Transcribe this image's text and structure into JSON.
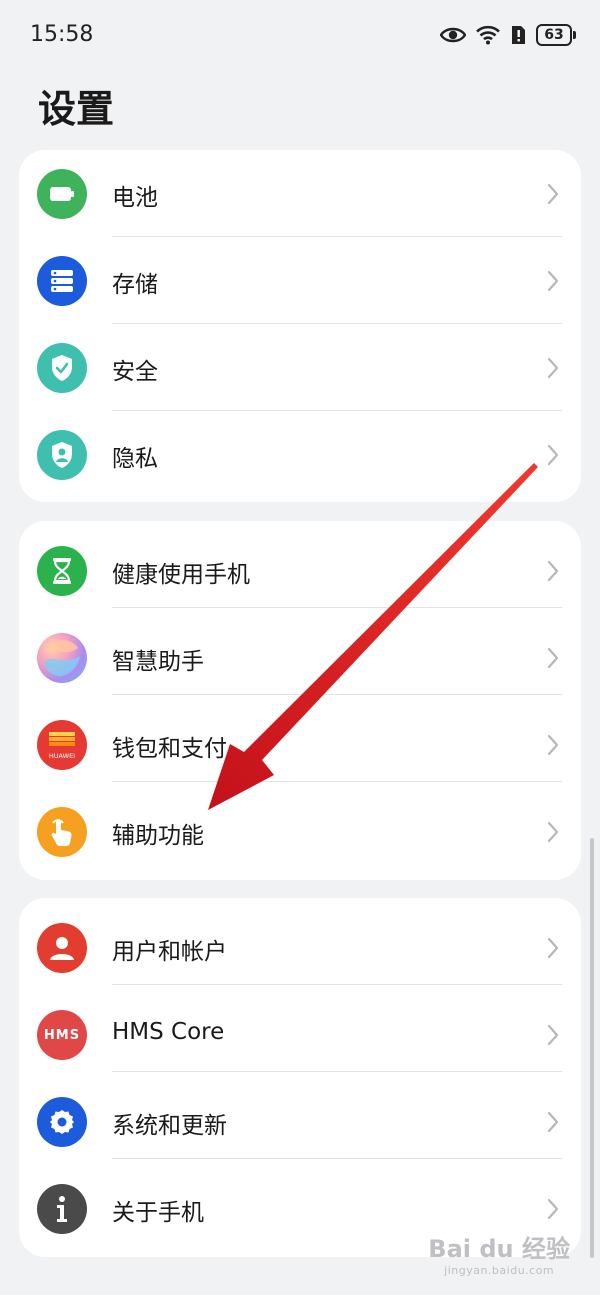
{
  "status_bar": {
    "time": "15:58",
    "battery": "63"
  },
  "page": {
    "title": "设置"
  },
  "groups": [
    {
      "items": [
        {
          "label": "电池",
          "icon": "battery-icon",
          "color": "#3fb35c"
        },
        {
          "label": "存储",
          "icon": "storage-icon",
          "color": "#1c5bdc"
        },
        {
          "label": "安全",
          "icon": "security-shield-icon",
          "color": "#3fbfae"
        },
        {
          "label": "隐私",
          "icon": "privacy-shield-icon",
          "color": "#3fbfae"
        }
      ]
    },
    {
      "items": [
        {
          "label": "健康使用手机",
          "icon": "hourglass-icon",
          "color": "#2cb24d"
        },
        {
          "label": "智慧助手",
          "icon": "assistant-icon",
          "color": "#b68ce8"
        },
        {
          "label": "钱包和支付",
          "icon": "wallet-icon",
          "color": "#e53a33",
          "icon_text": "HUAWEI"
        },
        {
          "label": "辅助功能",
          "icon": "accessibility-hand-icon",
          "color": "#f5a020"
        }
      ]
    },
    {
      "items": [
        {
          "label": "用户和帐户",
          "icon": "user-icon",
          "color": "#e33d2f"
        },
        {
          "label": "HMS Core",
          "icon": "hms-icon",
          "color": "#e04848",
          "icon_text": "HMS"
        },
        {
          "label": "系统和更新",
          "icon": "gear-icon",
          "color": "#1c5bdc"
        },
        {
          "label": "关于手机",
          "icon": "info-icon",
          "color": "#4a4a4a"
        }
      ]
    }
  ],
  "watermark": {
    "main": "Bai du 经验",
    "sub": "jingyan.baidu.com"
  }
}
